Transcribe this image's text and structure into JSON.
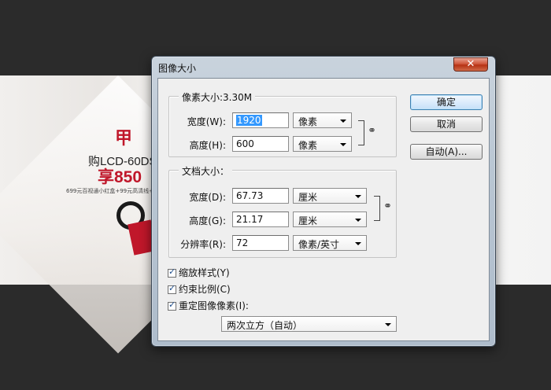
{
  "banner": {
    "logo": "甲",
    "line1": "购LCD-60DS",
    "line2": "享850",
    "line3": "699元百视通小红盒+99元高清线+"
  },
  "dialog": {
    "title": "图像大小",
    "close": "✕",
    "pixel_group": {
      "title": "像素大小:3.30M",
      "width_label": "宽度(W):",
      "width_value": "1920",
      "width_unit": "像素",
      "height_label": "高度(H):",
      "height_value": "600",
      "height_unit": "像素"
    },
    "doc_group": {
      "title": "文档大小：",
      "width_label": "宽度(D):",
      "width_value": "67.73",
      "width_unit": "厘米",
      "height_label": "高度(G):",
      "height_value": "21.17",
      "height_unit": "厘米",
      "res_label": "分辨率(R):",
      "res_value": "72",
      "res_unit": "像素/英寸"
    },
    "buttons": {
      "ok": "确定",
      "cancel": "取消",
      "auto": "自动(A)..."
    },
    "checks": [
      {
        "label": "缩放样式(Y)",
        "checked": true
      },
      {
        "label": "约束比例(C)",
        "checked": true
      },
      {
        "label": "重定图像像素(I):",
        "checked": true
      }
    ],
    "resample": "两次立方（自动）",
    "link_icon": "chain-link-icon"
  }
}
